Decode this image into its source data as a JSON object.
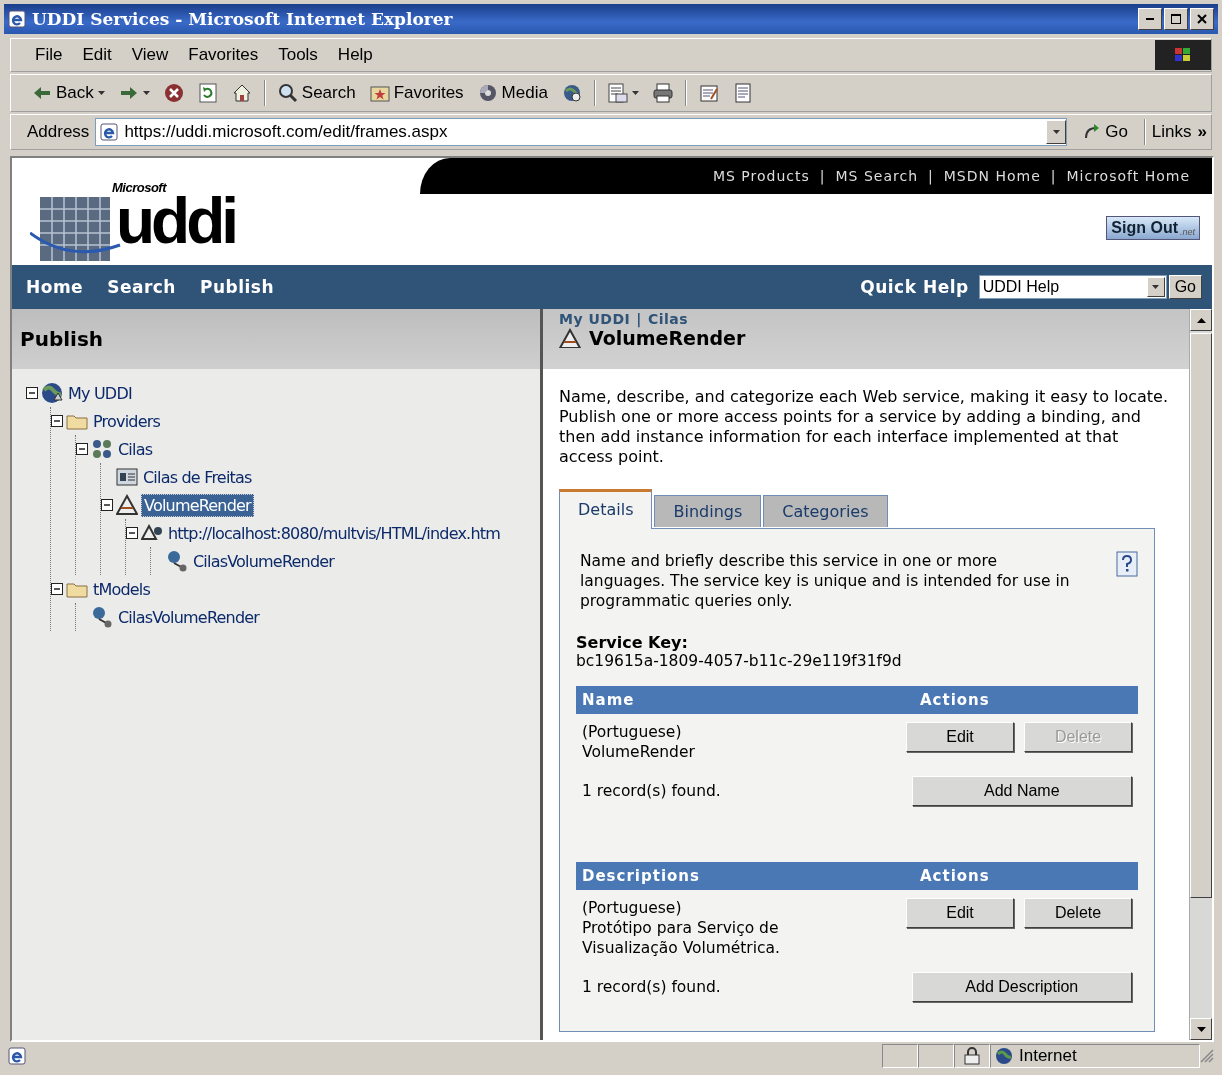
{
  "window": {
    "title": "UDDI Services - Microsoft Internet Explorer"
  },
  "menu": [
    "File",
    "Edit",
    "View",
    "Favorites",
    "Tools",
    "Help"
  ],
  "toolbar": [
    {
      "kind": "back",
      "label": "Back"
    },
    {
      "kind": "forward"
    },
    {
      "kind": "stop"
    },
    {
      "kind": "refresh"
    },
    {
      "kind": "home"
    },
    {
      "kind": "search",
      "label": "Search"
    },
    {
      "kind": "favorites",
      "label": "Favorites"
    },
    {
      "kind": "media",
      "label": "Media"
    },
    {
      "kind": "history"
    },
    {
      "kind": "mail"
    },
    {
      "kind": "print"
    },
    {
      "kind": "edit"
    },
    {
      "kind": "discuss"
    }
  ],
  "address": {
    "label": "Address",
    "value": "https://uddi.microsoft.com/edit/frames.aspx",
    "go": "Go",
    "links": "Links",
    "more": "»"
  },
  "site_header": {
    "brand": "Microsoft",
    "logo": "uddi",
    "top_links": [
      "MS Products",
      "MS Search",
      "MSDN Home",
      "Microsoft Home"
    ],
    "separator": "|",
    "sign_out": "Sign Out",
    "sign_out_badge": ".net"
  },
  "nav": {
    "items": [
      "Home",
      "Search",
      "Publish"
    ],
    "quick_help_label": "Quick Help",
    "quick_help_value": "UDDI Help",
    "go": "Go"
  },
  "left": {
    "title": "Publish",
    "tree": [
      {
        "label": "My UDDI",
        "kind": "globe",
        "selected": false,
        "expanded": true,
        "children": [
          {
            "label": "Providers",
            "kind": "folder",
            "selected": false,
            "expanded": true,
            "children": [
              {
                "label": "Cilas",
                "kind": "business",
                "selected": false,
                "expanded": true,
                "children": [
                  {
                    "label": "Cilas de Freitas",
                    "kind": "contact",
                    "selected": false
                  },
                  {
                    "label": "VolumeRender",
                    "kind": "service",
                    "selected": true,
                    "expanded": true,
                    "children": [
                      {
                        "label": "http://localhost:8080/multvis/HTML/index.htm",
                        "kind": "binding",
                        "selected": false,
                        "expanded": true,
                        "children": [
                          {
                            "label": "CilasVolumeRender",
                            "kind": "instance",
                            "selected": false
                          }
                        ]
                      }
                    ]
                  }
                ]
              }
            ]
          },
          {
            "label": "tModels",
            "kind": "folder",
            "selected": false,
            "expanded": true,
            "children": [
              {
                "label": "CilasVolumeRender",
                "kind": "tmodel",
                "selected": false
              }
            ]
          }
        ]
      }
    ]
  },
  "detail": {
    "breadcrumb": [
      "My UDDI",
      "Cilas"
    ],
    "breadcrumb_separator": "|",
    "title": "VolumeRender",
    "intro": "Name, describe, and categorize each Web service, making it easy to locate. Publish one or more access points for a service by adding a binding, and then add instance information for each interface implemented at that access point.",
    "tabs": [
      {
        "label": "Details",
        "selected": true
      },
      {
        "label": "Bindings",
        "selected": false
      },
      {
        "label": "Categories",
        "selected": false
      }
    ],
    "help_text": "Name and briefly describe this service in one or more languages. The service key is unique and is intended for use in programmatic queries only.",
    "service_key_label": "Service Key:",
    "service_key": "bc19615a-1809-4057-b11c-29e119f31f9d",
    "sections": [
      {
        "header": "Name",
        "actions_header": "Actions",
        "rows": [
          {
            "language": "(Portuguese)",
            "text": "VolumeRender",
            "buttons": [
              {
                "label": "Edit",
                "disabled": false
              },
              {
                "label": "Delete",
                "disabled": true
              }
            ]
          }
        ],
        "count": "1 record(s) found.",
        "add_button": "Add Name"
      },
      {
        "header": "Descriptions",
        "actions_header": "Actions",
        "rows": [
          {
            "language": "(Portuguese)",
            "text": "Protótipo para Serviço de Visualização Volumétrica.",
            "buttons": [
              {
                "label": "Edit",
                "disabled": false
              },
              {
                "label": "Delete",
                "disabled": false
              }
            ]
          }
        ],
        "count": "1 record(s) found.",
        "add_button": "Add Description"
      }
    ]
  },
  "status_bar": {
    "zone": "Internet"
  }
}
